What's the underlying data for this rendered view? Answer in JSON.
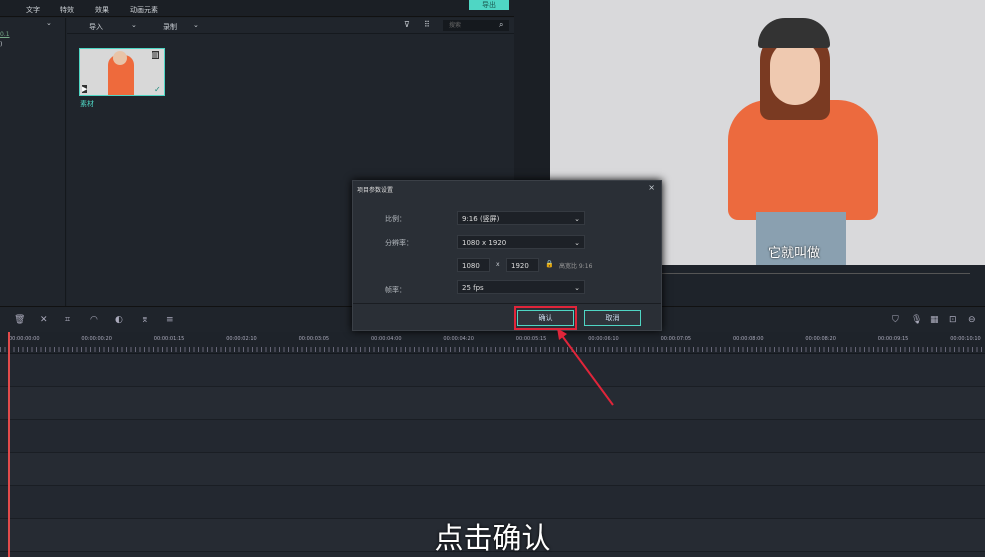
{
  "topbar": {
    "menu": [
      "文字",
      "特效",
      "效果",
      "动画元素"
    ],
    "export": "导出"
  },
  "left": {
    "lines": [
      "0.1",
      ")"
    ]
  },
  "media": {
    "import": "导入",
    "record": "录制",
    "search_placeholder": "搜索",
    "item_label": "素材"
  },
  "preview": {
    "subtitle": "它就叫做"
  },
  "dialog": {
    "title": "项目参数设置",
    "ratio_label": "比例：",
    "ratio_value": "9:16 (竖屏)",
    "resolution_label": "分辨率：",
    "resolution_value": "1080 x 1920",
    "width": "1080",
    "x": "x",
    "height": "1920",
    "aspect": "高宽比 9:16",
    "fps_label": "帧率：",
    "fps_value": "25 fps",
    "confirm": "确认",
    "cancel": "取消"
  },
  "timeline": {
    "ticks": [
      "00:00:00:00",
      "00:00:00:20",
      "00:00:01:15",
      "00:00:02:10",
      "00:00:03:05",
      "00:00:04:00",
      "00:00:04:20",
      "00:00:05:15",
      "00:00:06:10",
      "00:00:07:05",
      "00:00:08:00",
      "00:00:08:20",
      "00:00:09:15",
      "00:00:10:10"
    ]
  },
  "caption": "点击确认",
  "colors": {
    "accent": "#4fd6c4",
    "highlight": "#e0253a"
  }
}
